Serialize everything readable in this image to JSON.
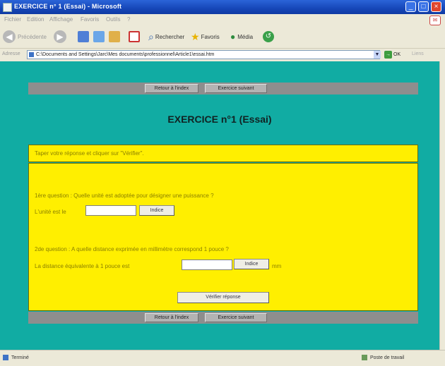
{
  "window": {
    "title": "EXERCICE n° 1 (Essai) - Microsoft",
    "controls": {
      "minimize": "_",
      "maximize": "□",
      "close": "×"
    }
  },
  "menubar": {
    "items": [
      "Fichier",
      "Edition",
      "Affichage",
      "Favoris",
      "Outils",
      "?"
    ]
  },
  "toolbar": {
    "back_label": "Précédente",
    "search_label": "Rechercher",
    "favorites_label": "Favoris",
    "media_label": "Média"
  },
  "address": {
    "label": "Adresse",
    "url": "C:\\Documents and Settings\\Jarc\\Mes documents\\professionnel\\Article1\\essai.htm",
    "go_label": "OK",
    "links_label": "Liens"
  },
  "nav_top": {
    "back_label": "Retour à l'index",
    "next_label": "Exercice suivant"
  },
  "page": {
    "title": "EXERCICE n°1 (Essai)"
  },
  "instructions": "Taper votre réponse et cliquer sur \"Vérifier\".",
  "questions": {
    "q1": {
      "text": "1ère question : Quelle unité est adoptée pour désigner une puissance ?",
      "prompt": "L'unité est le",
      "hint_label": "Indice"
    },
    "q2": {
      "text": "2de question : A quelle distance exprimée en millimètre correspond 1 pouce ?",
      "prompt": "La distance équivalente à 1 pouce est",
      "hint_label": "Indice",
      "unit": "mm"
    }
  },
  "verify_label": "Vérifier réponse",
  "nav_bottom": {
    "back_label": "Retour à l'index",
    "next_label": "Exercice suivant"
  },
  "status": {
    "left": "Terminé",
    "right": "Poste de travail"
  },
  "colors": {
    "background": "#11aca3",
    "panel": "#ffef00",
    "navbar": "#8e8e8e"
  }
}
